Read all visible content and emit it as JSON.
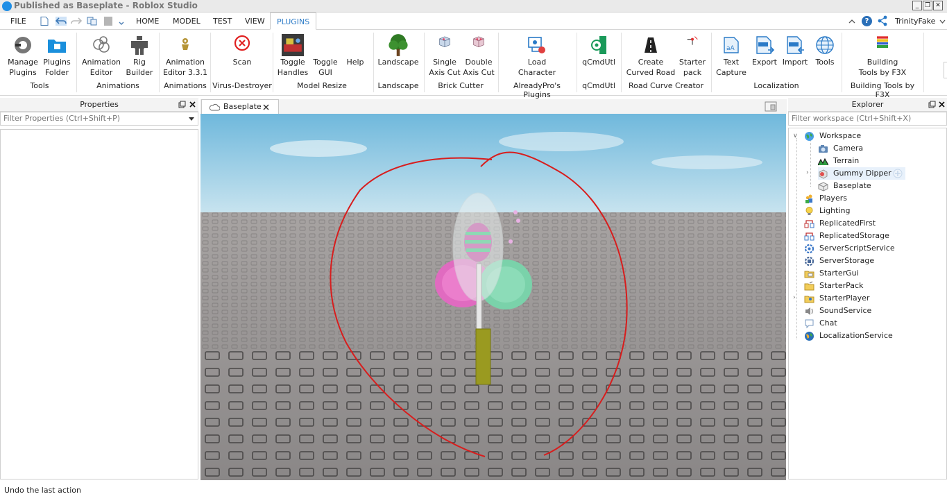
{
  "window": {
    "title": "Published as Baseplate - Roblox Studio",
    "minimize": "_",
    "restore": "❐",
    "close": "✕"
  },
  "menu": {
    "file": "FILE",
    "tabs": [
      "HOME",
      "MODEL",
      "TEST",
      "VIEW",
      "PLUGINS"
    ],
    "active_tab": "PLUGINS",
    "user": "TrinityFake"
  },
  "ribbon": {
    "buttons": [
      {
        "label": "Manage\nPlugins",
        "icon": "plug-icon"
      },
      {
        "label": "Plugins\nFolder",
        "icon": "folder-icon"
      },
      {
        "label": "Animation\nEditor",
        "icon": "animation-rings-icon"
      },
      {
        "label": "Rig\nBuilder",
        "icon": "rig-figure-icon"
      },
      {
        "label": "Animation\nEditor 3.3.1",
        "icon": "animation-dummy-icon"
      },
      {
        "label": "Scan",
        "icon": "virus-x-icon"
      },
      {
        "label": "Toggle\nHandles",
        "icon": "toggle-handles-icon"
      },
      {
        "label": "Toggle\nGUI",
        "icon": ""
      },
      {
        "label": "Help",
        "icon": ""
      },
      {
        "label": "Landscape",
        "icon": "tree-icon"
      },
      {
        "label": "Single\nAxis Cut",
        "icon": "brick-single-cut-icon"
      },
      {
        "label": "Double\nAxis Cut",
        "icon": "brick-double-cut-icon"
      },
      {
        "label": "Load\nCharacter",
        "icon": "load-character-icon"
      },
      {
        "label": "qCmdUtl",
        "icon": "qcmdutl-icon"
      },
      {
        "label": "Create\nCurved Road",
        "icon": "road-icon"
      },
      {
        "label": "Starter\npack",
        "icon": "starter-pack-icon"
      },
      {
        "label": "Text\nCapture",
        "icon": "text-capture-icon"
      },
      {
        "label": "Export",
        "icon": "csv-export-icon"
      },
      {
        "label": "Import",
        "icon": "csv-import-icon"
      },
      {
        "label": "Tools",
        "icon": "globe-icon"
      },
      {
        "label": "Building\nTools by F3X",
        "icon": "f3x-icon"
      }
    ],
    "groups": [
      "Tools",
      "Animations",
      "Animations",
      "Virus-Destroyer",
      "Model Resize",
      "Landscape",
      "Brick Cutter",
      "AlreadyPro's Plugins",
      "qCmdUtl",
      "Road Curve Creator",
      "Localization",
      "Building Tools by F3X"
    ]
  },
  "properties": {
    "title": "Properties",
    "filter_placeholder": "Filter Properties (Ctrl+Shift+P)"
  },
  "document": {
    "tab_label": "Baseplate"
  },
  "explorer": {
    "title": "Explorer",
    "filter_placeholder": "Filter workspace (Ctrl+Shift+X)",
    "items": [
      {
        "label": "Workspace",
        "icon": "workspace-globe-icon"
      },
      {
        "label": "Camera",
        "icon": "camera-icon"
      },
      {
        "label": "Terrain",
        "icon": "terrain-icon"
      },
      {
        "label": "Gummy Dipper",
        "icon": "model-icon"
      },
      {
        "label": "Baseplate",
        "icon": "part-icon"
      },
      {
        "label": "Players",
        "icon": "players-icon"
      },
      {
        "label": "Lighting",
        "icon": "lighting-bulb-icon"
      },
      {
        "label": "ReplicatedFirst",
        "icon": "replicated-first-icon"
      },
      {
        "label": "ReplicatedStorage",
        "icon": "replicated-storage-icon"
      },
      {
        "label": "ServerScriptService",
        "icon": "server-script-service-icon"
      },
      {
        "label": "ServerStorage",
        "icon": "server-storage-icon"
      },
      {
        "label": "StarterGui",
        "icon": "starter-gui-icon"
      },
      {
        "label": "StarterPack",
        "icon": "starter-pack-folder-icon"
      },
      {
        "label": "StarterPlayer",
        "icon": "starter-player-icon"
      },
      {
        "label": "SoundService",
        "icon": "sound-service-icon"
      },
      {
        "label": "Chat",
        "icon": "chat-icon"
      },
      {
        "label": "LocalizationService",
        "icon": "localization-service-icon"
      }
    ]
  },
  "status": {
    "text": "Undo the last action"
  },
  "colors": {
    "accent": "#2a7ac7",
    "sky": "#8fc6e0",
    "baseplate": "#8e8b8b",
    "annotation": "#d81d1d"
  }
}
